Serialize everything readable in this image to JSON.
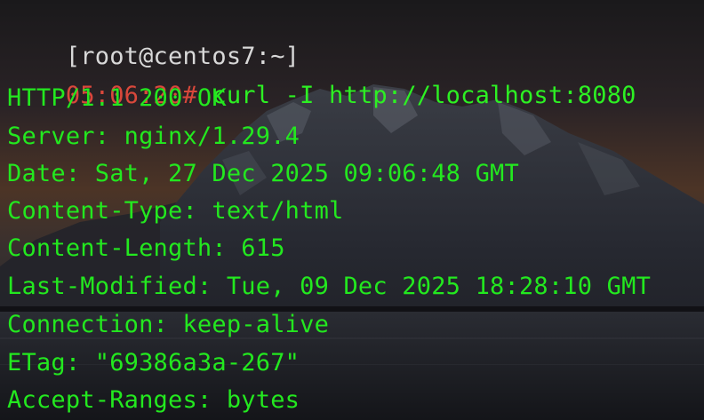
{
  "terminal": {
    "prompt_bracket": "[root@centos7:~]",
    "prompt_time": "05:06:20#",
    "command": " curl -I http://localhost:8080",
    "output": [
      "HTTP/1.1 200 OK",
      "Server: nginx/1.29.4",
      "Date: Sat, 27 Dec 2025 09:06:48 GMT",
      "Content-Type: text/html",
      "Content-Length: 615",
      "Last-Modified: Tue, 09 Dec 2025 18:28:10 GMT",
      "Connection: keep-alive",
      "ETag: \"69386a3a-267\"",
      "Accept-Ranges: bytes"
    ]
  },
  "colors": {
    "prompt": "#d8d8d8",
    "time": "#d9483b",
    "text": "#23e81f"
  },
  "background": {
    "icon": "mountain-lake-wallpaper"
  }
}
